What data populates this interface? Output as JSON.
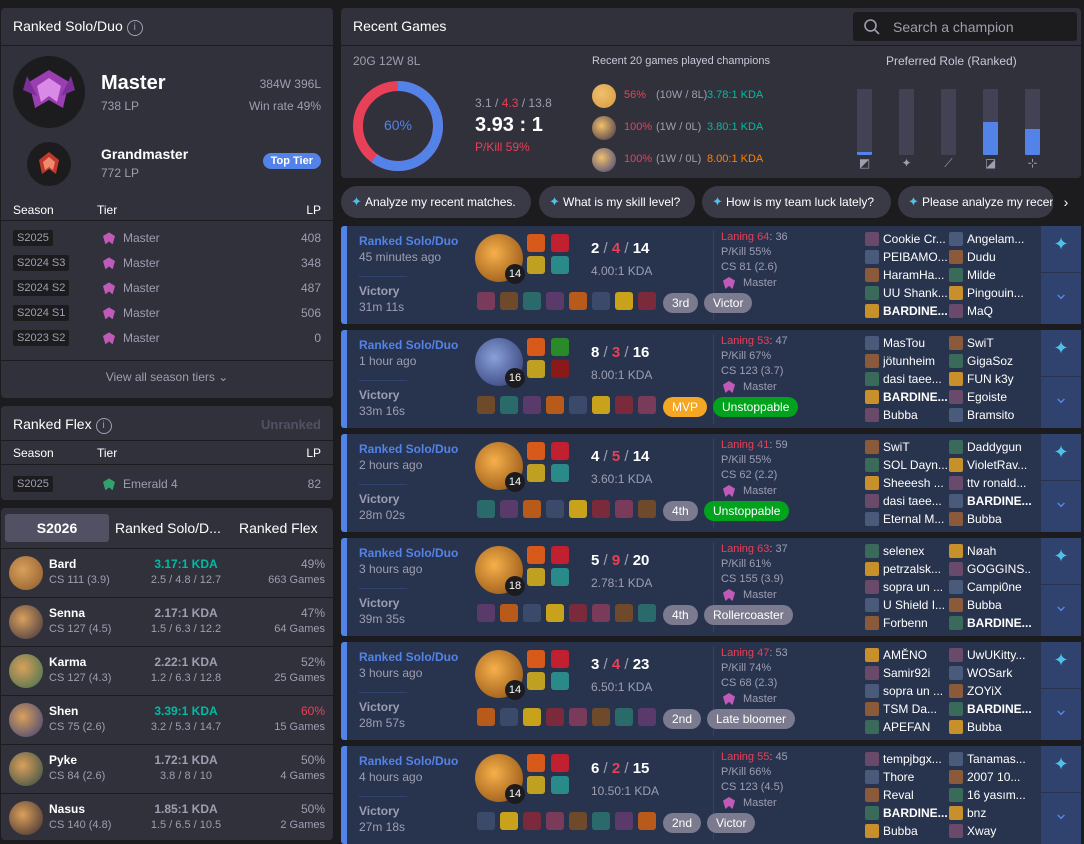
{
  "solo": {
    "title": "Ranked Solo/Duo",
    "tier": "Master",
    "lp": "738 LP",
    "wl": "384W 396L",
    "winrate": "Win rate 49%",
    "gm_tier": "Grandmaster",
    "gm_lp": "772 LP",
    "top_tier": "Top Tier",
    "h_season": "Season",
    "h_tier": "Tier",
    "h_lp": "LP",
    "seasons": [
      {
        "s": "S2025",
        "t": "Master",
        "lp": "408"
      },
      {
        "s": "S2024 S3",
        "t": "Master",
        "lp": "348"
      },
      {
        "s": "S2024 S2",
        "t": "Master",
        "lp": "487"
      },
      {
        "s": "S2024 S1",
        "t": "Master",
        "lp": "506"
      },
      {
        "s": "S2023 S2",
        "t": "Master",
        "lp": "0"
      }
    ],
    "view_all": "View all season tiers"
  },
  "flex": {
    "title": "Ranked Flex",
    "status": "Unranked",
    "h_season": "Season",
    "h_tier": "Tier",
    "h_lp": "LP",
    "s": "S2025",
    "t": "Emerald 4",
    "lp": "82"
  },
  "champ_tabs": {
    "t1": "S2026",
    "t2": "Ranked Solo/D...",
    "t3": "Ranked Flex"
  },
  "champs": [
    {
      "name": "Bard",
      "cs": "CS 111 (3.9)",
      "kda": "3.17:1 KDA",
      "kdal": "2.5 / 4.8 / 12.7",
      "wr": "49%",
      "games": "663 Games",
      "kc": "#00bba3",
      "wc": "#9e9eb1"
    },
    {
      "name": "Senna",
      "cs": "CS 127 (4.5)",
      "kda": "2.17:1 KDA",
      "kdal": "1.5 / 6.3 / 12.2",
      "wr": "47%",
      "games": "64 Games",
      "kc": "#9e9eb1",
      "wc": "#9e9eb1"
    },
    {
      "name": "Karma",
      "cs": "CS 127 (4.3)",
      "kda": "2.22:1 KDA",
      "kdal": "1.2 / 6.3 / 12.8",
      "wr": "52%",
      "games": "25 Games",
      "kc": "#9e9eb1",
      "wc": "#9e9eb1"
    },
    {
      "name": "Shen",
      "cs": "CS 75 (2.6)",
      "kda": "3.39:1 KDA",
      "kdal": "3.2 / 5.3 / 14.7",
      "wr": "60%",
      "games": "15 Games",
      "kc": "#00bba3",
      "wc": "#e84057"
    },
    {
      "name": "Pyke",
      "cs": "CS 84 (2.6)",
      "kda": "1.72:1 KDA",
      "kdal": "3.8 / 8 / 10",
      "wr": "50%",
      "games": "4 Games",
      "kc": "#9e9eb1",
      "wc": "#9e9eb1"
    },
    {
      "name": "Nasus",
      "cs": "CS 140 (4.8)",
      "kda": "1.85:1 KDA",
      "kdal": "1.5 / 6.5 / 10.5",
      "wr": "50%",
      "games": "2 Games",
      "kc": "#9e9eb1",
      "wc": "#9e9eb1"
    }
  ],
  "recent": {
    "title": "Recent Games",
    "search_placeholder": "Search a champion",
    "summary": "20G 12W 8L",
    "donut_pct": "60%",
    "winrate": 0.6,
    "k": "3.1",
    "d": "4.3",
    "a": "13.8",
    "kda": "3.93 : 1",
    "pkill": "P/Kill 59%",
    "champs_title": "Recent 20 games played champions",
    "champs": [
      {
        "wr": "56%",
        "wl": "(10W / 8L)",
        "kda": "3.78:1 KDA",
        "kc": "#00bba3"
      },
      {
        "wr": "100%",
        "wl": "(1W / 0L)",
        "kda": "3.80:1 KDA",
        "kc": "#00bba3"
      },
      {
        "wr": "100%",
        "wl": "(1W / 0L)",
        "kda": "8.00:1 KDA",
        "kc": "#ff8200"
      }
    ],
    "role_title": "Preferred Role (Ranked)",
    "roles": [
      0.05,
      0,
      0,
      0.5,
      0.4
    ]
  },
  "suggestions": [
    "Analyze my recent matches.",
    "What is my skill level?",
    "How is my team luck lately?",
    "Please analyze my recent"
  ],
  "games": [
    {
      "q": "Ranked Solo/Duo",
      "ago": "45 minutes ago",
      "res": "Victory",
      "dur": "31m 11s",
      "lvl": "14",
      "k": "2",
      "d": "4",
      "a": "14",
      "kda": "4.00:1 KDA",
      "lan": "Laning 64",
      "lan2": ": 36",
      "pk": "P/Kill 55%",
      "cs": "CS 81 (2.6)",
      "rank": "Master",
      "b1": "3rd",
      "b2": "Victor",
      "b1c": "#7b7a8e",
      "b2c": "#7b7a8e",
      "t1": [
        "Cookie Cr...",
        "PEIBAMO...",
        "HaramHa...",
        "UU Shank...",
        "BARDINE..."
      ],
      "t2": [
        "Angelam...",
        "Dudu",
        "Milde",
        "Pingouin...",
        "MaQ"
      ],
      "me": 1
    },
    {
      "q": "Ranked Solo/Duo",
      "ago": "1 hour ago",
      "res": "Victory",
      "dur": "33m 16s",
      "lvl": "16",
      "k": "8",
      "d": "3",
      "a": "16",
      "kda": "8.00:1 KDA",
      "lan": "Laning 53",
      "lan2": ": 47",
      "pk": "P/Kill 67%",
      "cs": "CS 123 (3.7)",
      "rank": "Master",
      "b1": "MVP",
      "b2": "Unstoppable",
      "b1c": "#f5a623",
      "b2c": "#00a31b",
      "t1": [
        "MasTou",
        "jötunheim",
        "dasi taee...",
        "BARDINE...",
        "Bubba"
      ],
      "t2": [
        "SwiT",
        "GigaSoz",
        "FUN k3y",
        "Egoiste",
        "Bramsito"
      ],
      "me": 1
    },
    {
      "q": "Ranked Solo/Duo",
      "ago": "2 hours ago",
      "res": "Victory",
      "dur": "28m 02s",
      "lvl": "14",
      "k": "4",
      "d": "5",
      "a": "14",
      "kda": "3.60:1 KDA",
      "lan": "Laning 41",
      "lan2": ": 59",
      "pk": "P/Kill 55%",
      "cs": "CS 62 (2.2)",
      "rank": "Master",
      "b1": "4th",
      "b2": "Unstoppable",
      "b1c": "#7b7a8e",
      "b2c": "#00a31b",
      "t1": [
        "SwiT",
        "SOL Dayn...",
        "Sheeesh ...",
        "dasi taee...",
        "Eternal M..."
      ],
      "t2": [
        "Daddygun",
        "VioletRav...",
        "ttv ronald...",
        "BARDINE...",
        "Bubba"
      ],
      "me": 2
    },
    {
      "q": "Ranked Solo/Duo",
      "ago": "3 hours ago",
      "res": "Victory",
      "dur": "39m 35s",
      "lvl": "18",
      "k": "5",
      "d": "9",
      "a": "20",
      "kda": "2.78:1 KDA",
      "lan": "Laning 63",
      "lan2": ": 37",
      "pk": "P/Kill 61%",
      "cs": "CS 155 (3.9)",
      "rank": "Master",
      "b1": "4th",
      "b2": "Rollercoaster",
      "b1c": "#7b7a8e",
      "b2c": "#7b7a8e",
      "t1": [
        "selenex",
        "petrzalsk...",
        "sopra un ...",
        "U Shield I...",
        "Forbenn"
      ],
      "t2": [
        "Nøah",
        "GOGGINS...",
        "Campi0ne",
        "Bubba",
        "BARDINE..."
      ],
      "me": 2
    },
    {
      "q": "Ranked Solo/Duo",
      "ago": "3 hours ago",
      "res": "Victory",
      "dur": "28m 57s",
      "lvl": "14",
      "k": "3",
      "d": "4",
      "a": "23",
      "kda": "6.50:1 KDA",
      "lan": "Laning 47",
      "lan2": ": 53",
      "pk": "P/Kill 74%",
      "cs": "CS 68 (2.3)",
      "rank": "Master",
      "b1": "2nd",
      "b2": "Late bloomer",
      "b1c": "#7b7a8e",
      "b2c": "#7b7a8e",
      "t1": [
        "AMĚNO",
        "Samir92i",
        "sopra un ...",
        "TSM Da...",
        "APEFAN"
      ],
      "t2": [
        "UwUKitty...",
        "WOSark",
        "ZOYiX",
        "BARDINE...",
        "Bubba"
      ],
      "me": 2
    },
    {
      "q": "Ranked Solo/Duo",
      "ago": "4 hours ago",
      "res": "Victory",
      "dur": "27m 18s",
      "lvl": "14",
      "k": "6",
      "d": "2",
      "a": "15",
      "kda": "10.50:1 KDA",
      "lan": "Laning 55",
      "lan2": ": 45",
      "pk": "P/Kill 66%",
      "cs": "CS 123 (4.5)",
      "rank": "Master",
      "b1": "2nd",
      "b2": "Victor",
      "b1c": "#7b7a8e",
      "b2c": "#7b7a8e",
      "t1": [
        "tempjbgx...",
        "Thore",
        "Reval",
        "BARDINE...",
        "Bubba"
      ],
      "t2": [
        "Tanamas...",
        "2007 10...",
        "16 yasım...",
        "bnz",
        "Xway"
      ],
      "me": 1
    }
  ]
}
